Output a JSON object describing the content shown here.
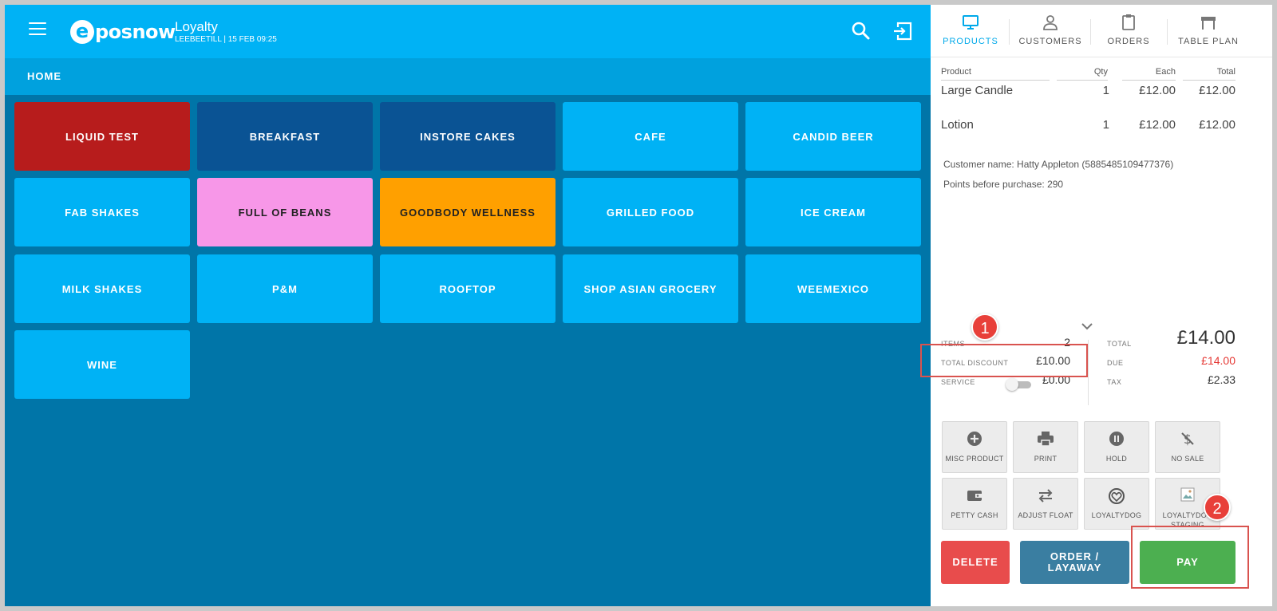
{
  "header": {
    "brand": {
      "mark": "e",
      "text": "posnow"
    },
    "title": "Loyalty",
    "subtitle": "LEEBEETILL | 15 FEB 09:25"
  },
  "breadcrumb": "HOME",
  "categories": [
    {
      "label": "LIQUID TEST",
      "color": "#b71c1c",
      "text_color": "#ffffff"
    },
    {
      "label": "BREAKFAST",
      "color": "#0a5394",
      "text_color": "#ffffff"
    },
    {
      "label": "INSTORE CAKES",
      "color": "#0a5394",
      "text_color": "#ffffff"
    },
    {
      "label": "CAFE",
      "color": "#00b2f5",
      "text_color": "#ffffff"
    },
    {
      "label": "CANDID BEER",
      "color": "#00b2f5",
      "text_color": "#ffffff"
    },
    {
      "label": "FAB SHAKES",
      "color": "#00b2f5",
      "text_color": "#ffffff"
    },
    {
      "label": "FULL OF BEANS",
      "color": "#f797e8",
      "text_color": "#222222"
    },
    {
      "label": "GOODBODY WELLNESS",
      "color": "#ffa000",
      "text_color": "#222222"
    },
    {
      "label": "GRILLED FOOD",
      "color": "#00b2f5",
      "text_color": "#ffffff"
    },
    {
      "label": "ICE CREAM",
      "color": "#00b2f5",
      "text_color": "#ffffff"
    },
    {
      "label": "MILK SHAKES",
      "color": "#00b2f5",
      "text_color": "#ffffff"
    },
    {
      "label": "P&M",
      "color": "#00b2f5",
      "text_color": "#ffffff"
    },
    {
      "label": "ROOFTOP",
      "color": "#00b2f5",
      "text_color": "#ffffff"
    },
    {
      "label": "SHOP ASIAN GROCERY",
      "color": "#00b2f5",
      "text_color": "#ffffff"
    },
    {
      "label": "WEEMEXICO",
      "color": "#00b2f5",
      "text_color": "#ffffff"
    },
    {
      "label": "WINE",
      "color": "#00b2f5",
      "text_color": "#ffffff"
    }
  ],
  "tabs": [
    {
      "label": "PRODUCTS",
      "icon": "monitor-icon",
      "active": true
    },
    {
      "label": "CUSTOMERS",
      "icon": "person-icon",
      "active": false
    },
    {
      "label": "ORDERS",
      "icon": "clipboard-icon",
      "active": false
    },
    {
      "label": "TABLE PLAN",
      "icon": "table-icon",
      "active": false
    }
  ],
  "order": {
    "columns": {
      "product": "Product",
      "qty": "Qty",
      "each": "Each",
      "total": "Total"
    },
    "items": [
      {
        "product": "Large Candle",
        "qty": "1",
        "each": "£12.00",
        "total": "£12.00"
      },
      {
        "product": "Lotion",
        "qty": "1",
        "each": "£12.00",
        "total": "£12.00"
      }
    ],
    "customer_name": "Customer name: Hatty Appleton (5885485109477376)",
    "points_before": "Points before purchase: 290"
  },
  "summary": {
    "items_label": "ITEMS",
    "items_value": "2",
    "discount_label": "TOTAL DISCOUNT",
    "discount_value": "£10.00",
    "service_label": "SERVICE",
    "service_value": "£0.00",
    "service_enabled": false,
    "total_label": "TOTAL",
    "total_value": "£14.00",
    "due_label": "DUE",
    "due_value": "£14.00",
    "tax_label": "TAX",
    "tax_value": "£2.33"
  },
  "functions": [
    {
      "label": "MISC PRODUCT",
      "icon": "plus-circle-icon"
    },
    {
      "label": "PRINT",
      "icon": "printer-icon"
    },
    {
      "label": "HOLD",
      "icon": "pause-circle-icon"
    },
    {
      "label": "NO SALE",
      "icon": "no-money-icon"
    },
    {
      "label": "PETTY CASH",
      "icon": "wallet-icon"
    },
    {
      "label": "ADJUST FLOAT",
      "icon": "swap-arrows-icon"
    },
    {
      "label": "LOYALTYDOG",
      "icon": "loyaltydog-icon"
    },
    {
      "label": "LOYALTYDOG STAGING",
      "icon": "broken-image-icon"
    }
  ],
  "actions": {
    "delete": "DELETE",
    "order_layaway": "ORDER / LAYAWAY",
    "pay": "PAY"
  },
  "callouts": [
    "1",
    "2"
  ],
  "colors": {
    "topbar": "#00b2f5",
    "breadcrumb_bar": "#00a1de",
    "background": "#0075a8",
    "active_tab": "#00a9ea",
    "due": "#e53935",
    "delete": "#e84c4c",
    "order_layaway": "#3a7ea1",
    "pay": "#4caf50",
    "callout": "#e8403a"
  }
}
